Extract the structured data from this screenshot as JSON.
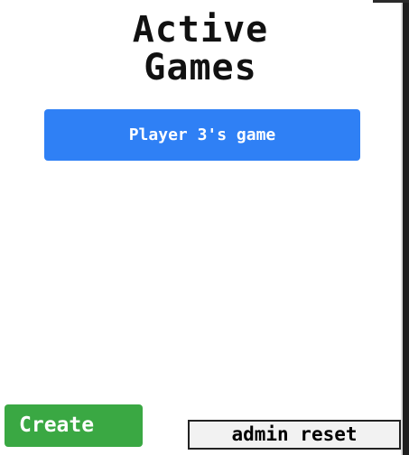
{
  "title": {
    "line1": "Active",
    "line2": "Games"
  },
  "games": [
    {
      "label": "Player 3's game"
    }
  ],
  "actions": {
    "create_label": "Create",
    "admin_reset_label": "admin reset"
  },
  "colors": {
    "game_button": "#2f80f5",
    "create_button": "#3aa843",
    "reset_button_bg": "#f2f2f2"
  }
}
